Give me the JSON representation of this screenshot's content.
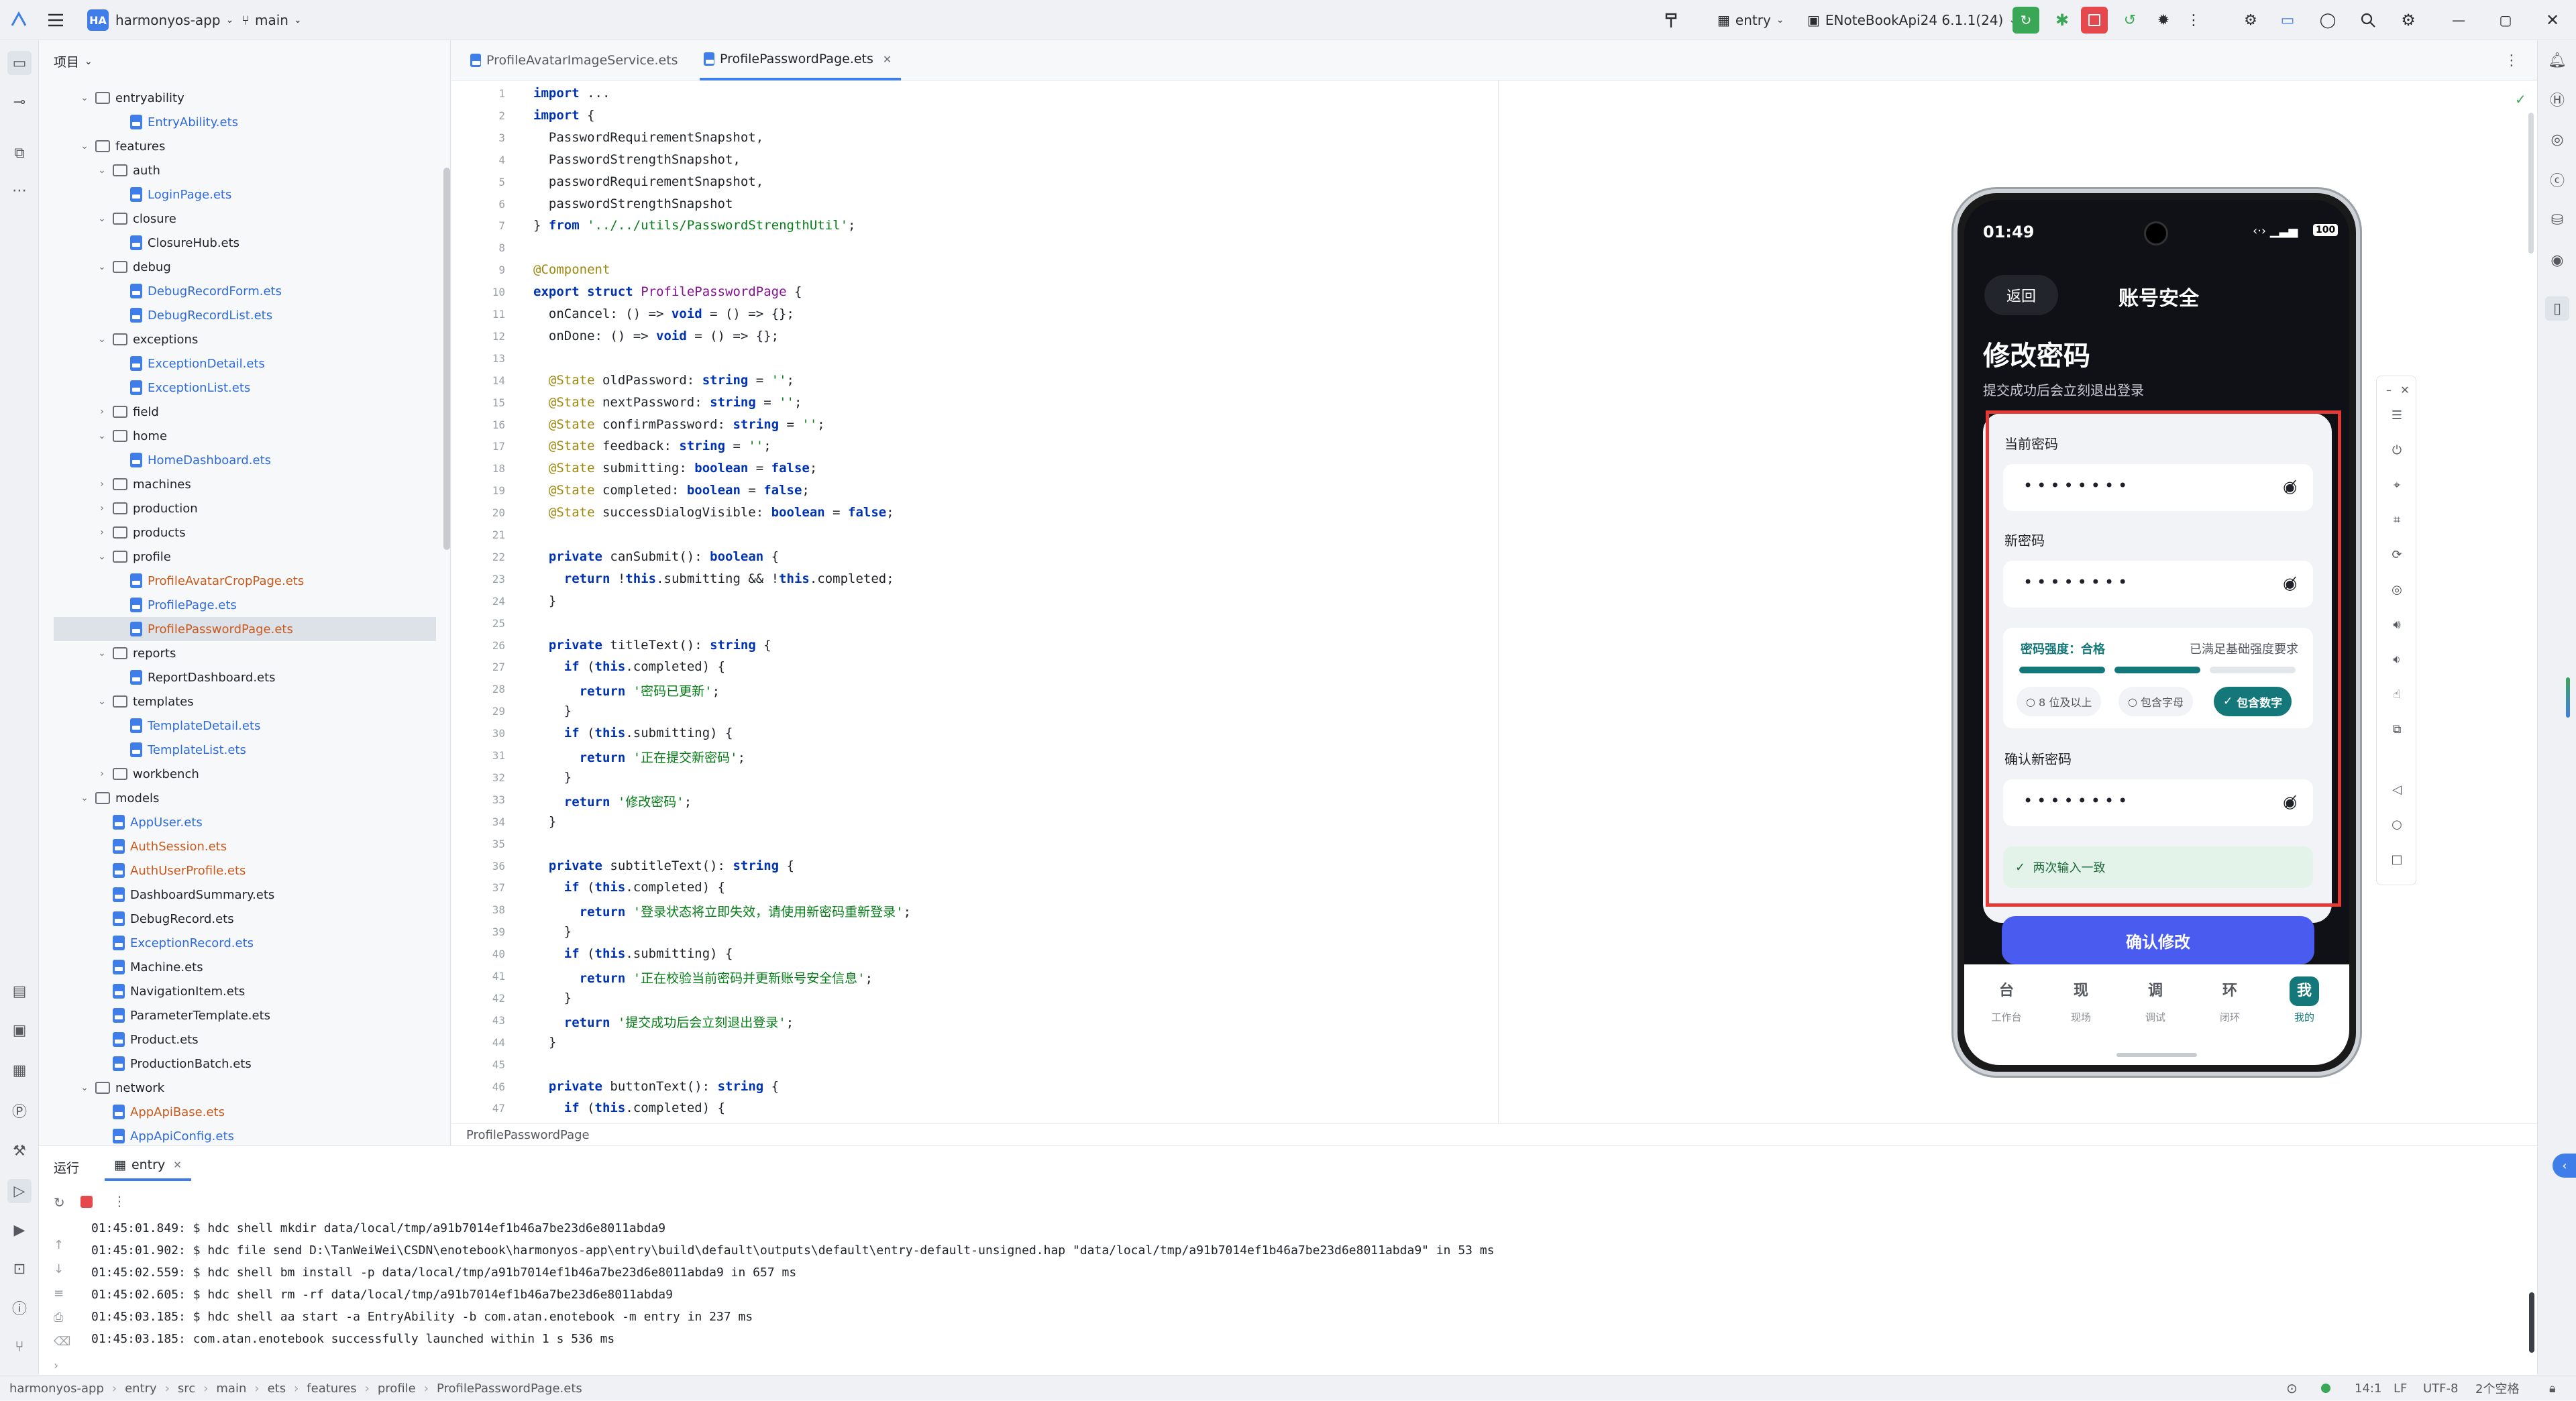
{
  "titlebar": {
    "project_badge": "HA",
    "project": "harmonyos-app",
    "branch": "main",
    "run_config": "entry",
    "device": "ENoteBookApi24 6.1.1(24)"
  },
  "project_panel": {
    "title": "项目"
  },
  "tree": [
    {
      "label": "entryability",
      "type": "folder",
      "depth": 5,
      "open": true
    },
    {
      "label": "EntryAbility.ets",
      "type": "file",
      "depth": 7,
      "color": "#2f6bd8"
    },
    {
      "label": "features",
      "type": "folder",
      "depth": 5,
      "open": true
    },
    {
      "label": "auth",
      "type": "folder",
      "depth": 6,
      "open": true
    },
    {
      "label": "LoginPage.ets",
      "type": "file",
      "depth": 7,
      "color": "#2f6bd8"
    },
    {
      "label": "closure",
      "type": "folder",
      "depth": 6,
      "open": true
    },
    {
      "label": "ClosureHub.ets",
      "type": "file",
      "depth": 7,
      "color": "#1f2329"
    },
    {
      "label": "debug",
      "type": "folder",
      "depth": 6,
      "open": true
    },
    {
      "label": "DebugRecordForm.ets",
      "type": "file",
      "depth": 7,
      "color": "#2f6bd8"
    },
    {
      "label": "DebugRecordList.ets",
      "type": "file",
      "depth": 7,
      "color": "#2f6bd8"
    },
    {
      "label": "exceptions",
      "type": "folder",
      "depth": 6,
      "open": true
    },
    {
      "label": "ExceptionDetail.ets",
      "type": "file",
      "depth": 7,
      "color": "#2f6bd8"
    },
    {
      "label": "ExceptionList.ets",
      "type": "file",
      "depth": 7,
      "color": "#2f6bd8"
    },
    {
      "label": "field",
      "type": "folder",
      "depth": 6,
      "open": false
    },
    {
      "label": "home",
      "type": "folder",
      "depth": 6,
      "open": true
    },
    {
      "label": "HomeDashboard.ets",
      "type": "file",
      "depth": 7,
      "color": "#2f6bd8"
    },
    {
      "label": "machines",
      "type": "folder",
      "depth": 6,
      "open": false
    },
    {
      "label": "production",
      "type": "folder",
      "depth": 6,
      "open": false
    },
    {
      "label": "products",
      "type": "folder",
      "depth": 6,
      "open": false
    },
    {
      "label": "profile",
      "type": "folder",
      "depth": 6,
      "open": true
    },
    {
      "label": "ProfileAvatarCropPage.ets",
      "type": "file",
      "depth": 7,
      "color": "#c85a1e"
    },
    {
      "label": "ProfilePage.ets",
      "type": "file",
      "depth": 7,
      "color": "#2f6bd8"
    },
    {
      "label": "ProfilePasswordPage.ets",
      "type": "file",
      "depth": 7,
      "color": "#c85a1e",
      "selected": true
    },
    {
      "label": "reports",
      "type": "folder",
      "depth": 6,
      "open": true
    },
    {
      "label": "ReportDashboard.ets",
      "type": "file",
      "depth": 7,
      "color": "#1f2329"
    },
    {
      "label": "templates",
      "type": "folder",
      "depth": 6,
      "open": true
    },
    {
      "label": "TemplateDetail.ets",
      "type": "file",
      "depth": 7,
      "color": "#2f6bd8"
    },
    {
      "label": "TemplateList.ets",
      "type": "file",
      "depth": 7,
      "color": "#2f6bd8"
    },
    {
      "label": "workbench",
      "type": "folder",
      "depth": 6,
      "open": false
    },
    {
      "label": "models",
      "type": "folder",
      "depth": 5,
      "open": true
    },
    {
      "label": "AppUser.ets",
      "type": "file",
      "depth": 6,
      "color": "#2f6bd8"
    },
    {
      "label": "AuthSession.ets",
      "type": "file",
      "depth": 6,
      "color": "#c85a1e"
    },
    {
      "label": "AuthUserProfile.ets",
      "type": "file",
      "depth": 6,
      "color": "#c85a1e"
    },
    {
      "label": "DashboardSummary.ets",
      "type": "file",
      "depth": 6,
      "color": "#1f2329"
    },
    {
      "label": "DebugRecord.ets",
      "type": "file",
      "depth": 6,
      "color": "#1f2329"
    },
    {
      "label": "ExceptionRecord.ets",
      "type": "file",
      "depth": 6,
      "color": "#2f6bd8"
    },
    {
      "label": "Machine.ets",
      "type": "file",
      "depth": 6,
      "color": "#1f2329"
    },
    {
      "label": "NavigationItem.ets",
      "type": "file",
      "depth": 6,
      "color": "#1f2329"
    },
    {
      "label": "ParameterTemplate.ets",
      "type": "file",
      "depth": 6,
      "color": "#1f2329"
    },
    {
      "label": "Product.ets",
      "type": "file",
      "depth": 6,
      "color": "#1f2329"
    },
    {
      "label": "ProductionBatch.ets",
      "type": "file",
      "depth": 6,
      "color": "#1f2329"
    },
    {
      "label": "network",
      "type": "folder",
      "depth": 5,
      "open": true
    },
    {
      "label": "AppApiBase.ets",
      "type": "file",
      "depth": 6,
      "color": "#c85a1e"
    },
    {
      "label": "AppApiConfig.ets",
      "type": "file",
      "depth": 6,
      "color": "#2f6bd8"
    }
  ],
  "editor_tabs": [
    {
      "label": "ProfileAvatarImageService.ets",
      "active": false
    },
    {
      "label": "ProfilePasswordPage.ets",
      "active": true
    }
  ],
  "code_lines": [
    {
      "n": "1",
      "t": "import ..."
    },
    {
      "n": "2",
      "t": "import {"
    },
    {
      "n": "3",
      "t": "  PasswordRequirementSnapshot,"
    },
    {
      "n": "4",
      "t": "  PasswordStrengthSnapshot,"
    },
    {
      "n": "5",
      "t": "  passwordRequirementSnapshot,"
    },
    {
      "n": "6",
      "t": "  passwordStrengthSnapshot"
    },
    {
      "n": "7",
      "t": "} from '../../utils/PasswordStrengthUtil';"
    },
    {
      "n": "8",
      "t": ""
    },
    {
      "n": "9",
      "t": "@Component"
    },
    {
      "n": "10",
      "t": "export struct ProfilePasswordPage {"
    },
    {
      "n": "11",
      "t": "  onCancel: () => void = () => {};"
    },
    {
      "n": "12",
      "t": "  onDone: () => void = () => {};"
    },
    {
      "n": "13",
      "t": ""
    },
    {
      "n": "14",
      "t": "  @State oldPassword: string = '';"
    },
    {
      "n": "15",
      "t": "  @State nextPassword: string = '';"
    },
    {
      "n": "16",
      "t": "  @State confirmPassword: string = '';"
    },
    {
      "n": "17",
      "t": "  @State feedback: string = '';"
    },
    {
      "n": "18",
      "t": "  @State submitting: boolean = false;"
    },
    {
      "n": "19",
      "t": "  @State completed: boolean = false;"
    },
    {
      "n": "20",
      "t": "  @State successDialogVisible: boolean = false;"
    },
    {
      "n": "21",
      "t": ""
    },
    {
      "n": "22",
      "t": "  private canSubmit(): boolean {"
    },
    {
      "n": "23",
      "t": "    return !this.submitting && !this.completed;"
    },
    {
      "n": "24",
      "t": "  }"
    },
    {
      "n": "25",
      "t": ""
    },
    {
      "n": "26",
      "t": "  private titleText(): string {"
    },
    {
      "n": "27",
      "t": "    if (this.completed) {"
    },
    {
      "n": "28",
      "t": "      return '密码已更新';"
    },
    {
      "n": "29",
      "t": "    }"
    },
    {
      "n": "30",
      "t": "    if (this.submitting) {"
    },
    {
      "n": "31",
      "t": "      return '正在提交新密码';"
    },
    {
      "n": "32",
      "t": "    }"
    },
    {
      "n": "33",
      "t": "    return '修改密码';"
    },
    {
      "n": "34",
      "t": "  }"
    },
    {
      "n": "35",
      "t": ""
    },
    {
      "n": "36",
      "t": "  private subtitleText(): string {"
    },
    {
      "n": "37",
      "t": "    if (this.completed) {"
    },
    {
      "n": "38",
      "t": "      return '登录状态将立即失效，请使用新密码重新登录';"
    },
    {
      "n": "39",
      "t": "    }"
    },
    {
      "n": "40",
      "t": "    if (this.submitting) {"
    },
    {
      "n": "41",
      "t": "      return '正在校验当前密码并更新账号安全信息';"
    },
    {
      "n": "42",
      "t": "    }"
    },
    {
      "n": "43",
      "t": "    return '提交成功后会立刻退出登录';"
    },
    {
      "n": "44",
      "t": "  }"
    },
    {
      "n": "45",
      "t": ""
    },
    {
      "n": "46",
      "t": "  private buttonText(): string {"
    },
    {
      "n": "47",
      "t": "    if (this.completed) {"
    }
  ],
  "editor_breadcrumb": "ProfilePasswordPage",
  "phone": {
    "time": "01:49",
    "battery": "100",
    "back_label": "返回",
    "header_title": "账号安全",
    "title": "修改密码",
    "subtitle": "提交成功后会立刻退出登录",
    "current_label": "当前密码",
    "current_value": "••••••••",
    "new_label": "新密码",
    "new_value": "••••••••",
    "strength_label": "密码强度：合格",
    "strength_note": "已满足基础强度要求",
    "strength_level": 0.67,
    "req1": "8 位及以上",
    "req2": "包含字母",
    "req3": "包含数字",
    "confirm_label": "确认新密码",
    "confirm_value": "••••••••",
    "match_text": "两次输入一致",
    "submit": "确认修改",
    "nav": [
      {
        "icon": "台",
        "label": "工作台"
      },
      {
        "icon": "现",
        "label": "现场"
      },
      {
        "icon": "调",
        "label": "调试"
      },
      {
        "icon": "环",
        "label": "闭环"
      },
      {
        "icon": "我",
        "label": "我的",
        "active": true
      }
    ],
    "accent": "#4a5cf0",
    "dark": "#0f1116",
    "teal": "#14787a",
    "red": "#e53935"
  },
  "run_panel": {
    "tab_title": "运行",
    "config": "entry",
    "logs": [
      "01:45:01.849: $ hdc shell mkdir data/local/tmp/a91b7014ef1b46a7be23d6e8011abda9",
      "01:45:01.902: $ hdc file send D:\\TanWeiWei\\CSDN\\enotebook\\harmonyos-app\\entry\\build\\default\\outputs\\default\\entry-default-unsigned.hap \"data/local/tmp/a91b7014ef1b46a7be23d6e8011abda9\" in 53 ms",
      "01:45:02.559: $ hdc shell bm install -p data/local/tmp/a91b7014ef1b46a7be23d6e8011abda9 in 657 ms",
      "01:45:02.605: $ hdc shell rm -rf data/local/tmp/a91b7014ef1b46a7be23d6e8011abda9",
      "01:45:03.185: $ hdc shell aa start -a EntryAbility -b com.atan.enotebook -m entry in 237 ms",
      "01:45:03.185: com.atan.enotebook successfully launched within 1 s 536 ms"
    ]
  },
  "statusbar": {
    "path": [
      "harmonyos-app",
      "entry",
      "src",
      "main",
      "ets",
      "features",
      "profile",
      "ProfilePasswordPage.ets"
    ],
    "position": "14:1",
    "line_sep": "LF",
    "encoding": "UTF-8",
    "indent": "2个空格"
  },
  "ime": {
    "lang": "中"
  }
}
